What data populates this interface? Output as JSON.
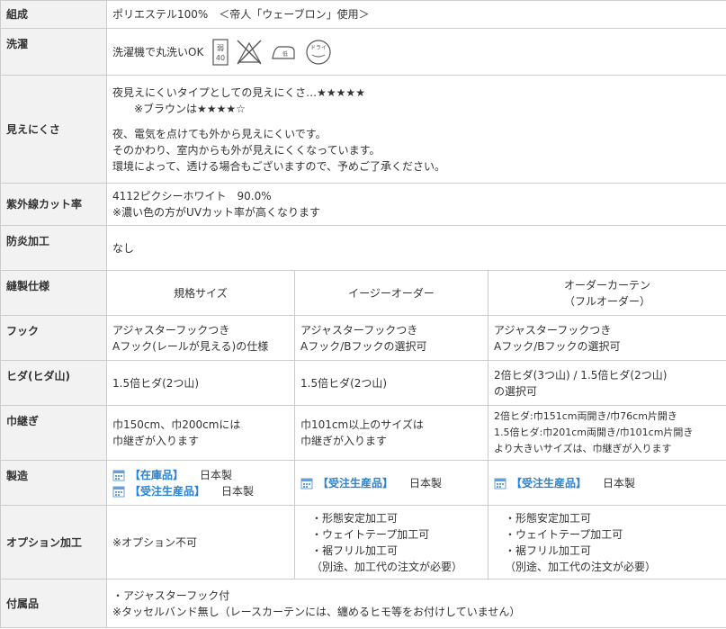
{
  "rows": {
    "composition": {
      "label": "組成",
      "value": "ポリエステル100%　＜帝人「ウェーブロン」使用＞"
    },
    "washing": {
      "label": "洗濯",
      "value": "洗濯機で丸洗いOK",
      "icons": [
        "wash-40-icon",
        "no-bleach-icon",
        "iron-low-icon",
        "dry-clean-icon"
      ],
      "icon_text": {
        "wash_kanji": "弱",
        "wash_temp": "40",
        "iron_low": "低",
        "dry_label": "ドライ"
      }
    },
    "visibility": {
      "label": "見えにくさ",
      "line1": "夜見えにくいタイプとしての見えにくさ…★★★★★",
      "line2": "※ブラウンは★★★★☆",
      "line3": "夜、電気を点けても外から見えにくいです。",
      "line4": "そのかわり、室内からも外が見えにくくなっています。",
      "line5": "環境によって、透ける場合もございますので、予めご了承ください。"
    },
    "uv": {
      "label": "紫外線カット率",
      "line1": "4112ピクシーホワイト　90.0%",
      "line2": "※濃い色の方がUVカット率が高くなります"
    },
    "flame": {
      "label": "防炎加工",
      "value": "なし"
    },
    "sewing": {
      "label": "縫製仕様",
      "col1": "規格サイズ",
      "col2": "イージーオーダー",
      "col3_line1": "オーダーカーテン",
      "col3_line2": "（フルオーダー）"
    },
    "hook": {
      "label": "フック",
      "c1_line1": "アジャスターフックつき",
      "c1_line2": "Aフック(レールが見える)の仕様",
      "c2_line1": "アジャスターフックつき",
      "c2_line2": "Aフック/Bフックの選択可",
      "c3_line1": "アジャスターフックつき",
      "c3_line2": "Aフック/Bフックの選択可"
    },
    "pleat": {
      "label": "ヒダ(ヒダ山)",
      "c1": "1.5倍ヒダ(2つ山)",
      "c2": "1.5倍ヒダ(2つ山)",
      "c3_line1": "2倍ヒダ(3つ山) / 1.5倍ヒダ(2つ山)",
      "c3_line2": "の選択可"
    },
    "seam": {
      "label": "巾継ぎ",
      "c1_line1": "巾150cm、巾200cmには",
      "c1_line2": "巾継ぎが入ります",
      "c2_line1": "巾101cm以上のサイズは",
      "c2_line2": "巾継ぎが入ります",
      "c3_line1": "2倍ヒダ:巾151cm両開き/巾76cm片開き",
      "c3_line2": "1.5倍ヒダ:巾201cm両開き/巾101cm片開き",
      "c3_line3": "より大きいサイズは、巾継ぎが入ります"
    },
    "manufacture": {
      "label": "製造",
      "c1_a_name": "【在庫品】",
      "c1_a_origin": "日本製",
      "c1_b_name": "【受注生産品】",
      "c1_b_origin": "日本製",
      "c2_name": "【受注生産品】",
      "c2_origin": "日本製",
      "c3_name": "【受注生産品】",
      "c3_origin": "日本製"
    },
    "option": {
      "label": "オプション加工",
      "c1": "※オプション不可",
      "c2_l1": "・形態安定加工可",
      "c2_l2": "・ウェイトテープ加工可",
      "c2_l3": "・裾フリル加工可",
      "c2_l4": "（別途、加工代の注文が必要）",
      "c3_l1": "・形態安定加工可",
      "c3_l2": "・ウェイトテープ加工可",
      "c3_l3": "・裾フリル加工可",
      "c3_l4": "（別途、加工代の注文が必要）"
    },
    "accessory": {
      "label": "付属品",
      "line1": "・アジャスターフック付",
      "line2": "※タッセルバンド無し（レースカーテンには、纏めるヒモ等をお付けしていません）"
    }
  },
  "colors": {
    "label_bg": "#f2f2f2",
    "border": "#cccccc",
    "accent_blue": "#2a82d0",
    "text": "#333333"
  }
}
